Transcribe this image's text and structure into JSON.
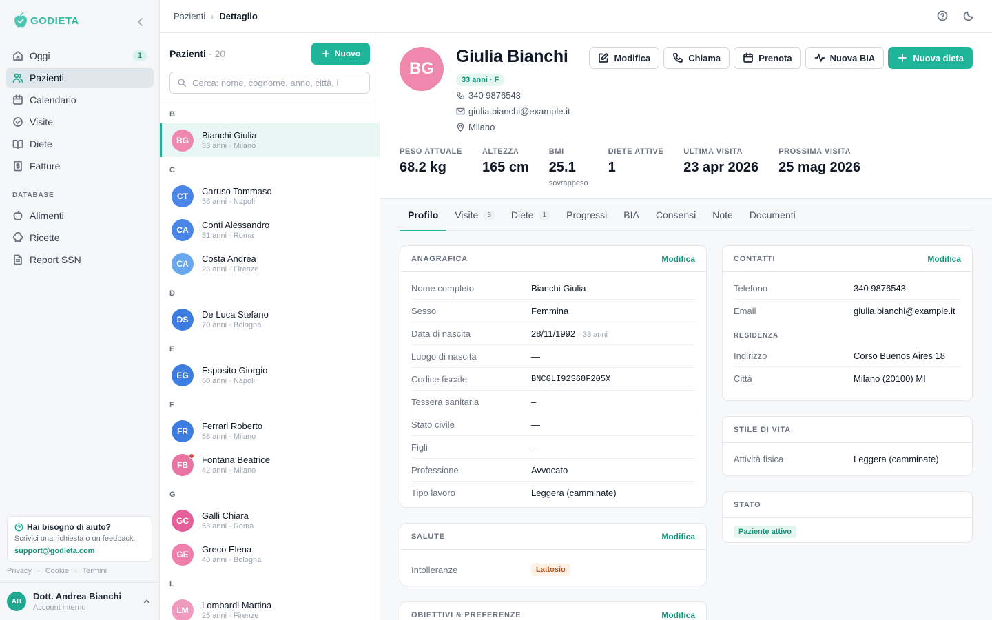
{
  "app": {
    "brand": "GODIETA",
    "accent": "#1fb59a"
  },
  "sidebar": {
    "items": [
      {
        "label": "Oggi",
        "icon": "home-icon",
        "count": "1"
      },
      {
        "label": "Pazienti",
        "icon": "users-icon"
      },
      {
        "label": "Calendario",
        "icon": "calendar-icon"
      },
      {
        "label": "Visite",
        "icon": "check-circle-icon"
      },
      {
        "label": "Diete",
        "icon": "book-icon"
      },
      {
        "label": "Fatture",
        "icon": "invoice-icon"
      }
    ],
    "section_label": "DATABASE",
    "db_items": [
      {
        "label": "Alimenti",
        "icon": "apple-icon"
      },
      {
        "label": "Ricette",
        "icon": "chef-hat-icon"
      },
      {
        "label": "Report SSN",
        "icon": "report-icon"
      }
    ],
    "help": {
      "title": "Hai bisogno di aiuto?",
      "text": "Scrivici una richiesta o un feedback.",
      "link": "support@godieta.com"
    },
    "legal": [
      "Privacy",
      "Cookie",
      "Termini"
    ],
    "user": {
      "initials": "AB",
      "name": "Dott. Andrea Bianchi",
      "role": "Account interno"
    }
  },
  "topbar": {
    "breadcrumb": [
      "Pazienti",
      "Dettaglio"
    ]
  },
  "patients": {
    "title": "Pazienti",
    "count": "20",
    "new_label": "Nuovo",
    "search_placeholder": "Cerca: nome, cognome, anno, città, i",
    "groups": [
      {
        "letter": "B",
        "items": [
          {
            "initials": "BG",
            "name": "Bianchi Giulia",
            "meta": "33 anni · Milano",
            "color": "#ee88ac",
            "selected": true
          }
        ]
      },
      {
        "letter": "C",
        "items": [
          {
            "initials": "CT",
            "name": "Caruso Tommaso",
            "meta": "56 anni · Napoli",
            "color": "#4a86e8"
          },
          {
            "initials": "CA",
            "name": "Conti Alessandro",
            "meta": "51 anni · Roma",
            "color": "#4a86e8"
          },
          {
            "initials": "CA",
            "name": "Costa Andrea",
            "meta": "23 anni · Firenze",
            "color": "#6aa8ee"
          }
        ]
      },
      {
        "letter": "D",
        "items": [
          {
            "initials": "DS",
            "name": "De Luca Stefano",
            "meta": "70 anni · Bologna",
            "color": "#3d7de0"
          }
        ]
      },
      {
        "letter": "E",
        "items": [
          {
            "initials": "EG",
            "name": "Esposito Giorgio",
            "meta": "60 anni · Napoli",
            "color": "#3d7de0"
          }
        ]
      },
      {
        "letter": "F",
        "items": [
          {
            "initials": "FR",
            "name": "Ferrari Roberto",
            "meta": "58 anni · Milano",
            "color": "#3d7de0"
          },
          {
            "initials": "FB",
            "name": "Fontana Beatrice",
            "meta": "42 anni · Milano",
            "color": "#e874a4",
            "alert": true
          }
        ]
      },
      {
        "letter": "G",
        "items": [
          {
            "initials": "GC",
            "name": "Galli Chiara",
            "meta": "53 anni · Roma",
            "color": "#e4609a"
          },
          {
            "initials": "GE",
            "name": "Greco Elena",
            "meta": "40 anni · Bologna",
            "color": "#ee7eab"
          }
        ]
      },
      {
        "letter": "L",
        "items": [
          {
            "initials": "LM",
            "name": "Lombardi Martina",
            "meta": "25 anni · Firenze",
            "color": "#f09bbd"
          }
        ]
      }
    ]
  },
  "detail": {
    "initials": "BG",
    "name": "Giulia Bianchi",
    "age_badge": "33 anni · F",
    "phone": "340 9876543",
    "email": "giulia.bianchi@example.it",
    "city": "Milano",
    "actions": {
      "edit": "Modifica",
      "call": "Chiama",
      "book": "Prenota",
      "bia": "Nuova BIA",
      "diet": "Nuova dieta"
    },
    "stats": [
      {
        "label": "PESO ATTUALE",
        "value": "68.2 kg",
        "sub": ""
      },
      {
        "label": "ALTEZZA",
        "value": "165 cm",
        "sub": ""
      },
      {
        "label": "BMI",
        "value": "25.1",
        "sub": "sovrappeso"
      },
      {
        "label": "DIETE ATTIVE",
        "value": "1",
        "sub": ""
      },
      {
        "label": "ULTIMA VISITA",
        "value": "23 apr 2026",
        "sub": ""
      },
      {
        "label": "PROSSIMA VISITA",
        "value": "25 mag 2026",
        "sub": ""
      }
    ],
    "tabs": [
      {
        "label": "Profilo",
        "count": ""
      },
      {
        "label": "Visite",
        "count": "3"
      },
      {
        "label": "Diete",
        "count": "1"
      },
      {
        "label": "Progressi",
        "count": ""
      },
      {
        "label": "BIA",
        "count": ""
      },
      {
        "label": "Consensi",
        "count": ""
      },
      {
        "label": "Note",
        "count": ""
      },
      {
        "label": "Documenti",
        "count": ""
      }
    ],
    "edit_label": "Modifica",
    "anagrafica": {
      "title": "ANAGRAFICA",
      "rows": [
        {
          "k": "Nome completo",
          "v": "Bianchi Giulia"
        },
        {
          "k": "Sesso",
          "v": "Femmina"
        },
        {
          "k": "Data di nascita",
          "v": "28/11/1992",
          "sub": "· 33 anni"
        },
        {
          "k": "Luogo di nascita",
          "v": "—"
        },
        {
          "k": "Codice fiscale",
          "v": "BNCGLI92S68F205X",
          "mono": true
        },
        {
          "k": "Tessera sanitaria",
          "v": "–"
        },
        {
          "k": "Stato civile",
          "v": "—"
        },
        {
          "k": "Figli",
          "v": "—"
        },
        {
          "k": "Professione",
          "v": "Avvocato"
        },
        {
          "k": "Tipo lavoro",
          "v": "Leggera (camminate)"
        }
      ]
    },
    "salute": {
      "title": "SALUTE",
      "label": "Intolleranze",
      "pill": "Lattosio"
    },
    "obiettivi": {
      "title": "OBIETTIVI & PREFERENZE"
    },
    "contatti": {
      "title": "CONTATTI",
      "rows": [
        {
          "k": "Telefono",
          "v": "340 9876543"
        },
        {
          "k": "Email",
          "v": "giulia.bianchi@example.it"
        }
      ],
      "residenza_label": "RESIDENZA",
      "residenza": [
        {
          "k": "Indirizzo",
          "v": "Corso Buenos Aires 18"
        },
        {
          "k": "Città",
          "v": "Milano (20100) MI"
        }
      ]
    },
    "stile": {
      "title": "STILE DI VITA",
      "rows": [
        {
          "k": "Attività fisica",
          "v": "Leggera (camminate)"
        }
      ]
    },
    "stato": {
      "title": "STATO",
      "pill": "Paziente attivo"
    }
  }
}
